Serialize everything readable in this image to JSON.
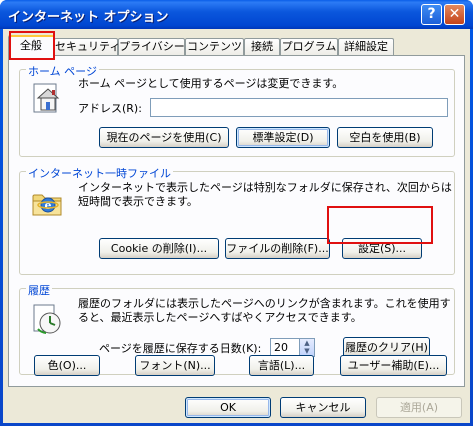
{
  "window": {
    "title": "インターネット オプション",
    "help_label": "?",
    "close_label": "✕"
  },
  "tabs": [
    "全般",
    "セキュリティ",
    "プライバシー",
    "コンテンツ",
    "接続",
    "プログラム",
    "詳細設定"
  ],
  "home": {
    "title": "ホーム ページ",
    "description": "ホーム ページとして使用するページは変更できます。",
    "address_label": "アドレス(R):",
    "address_value": "",
    "btn_current": "現在のページを使用(C)",
    "btn_default": "標準設定(D)",
    "btn_blank": "空白を使用(B)"
  },
  "temp_files": {
    "title": "インターネット一時ファイル",
    "description_line1": "インターネットで表示したページは特別なフォルダに保存され、次回からは",
    "description_line2": "短時間で表示できます。",
    "btn_delete_cookies": "Cookie の削除(I)...",
    "btn_delete_files": "ファイルの削除(F)...",
    "btn_settings": "設定(S)..."
  },
  "history": {
    "title": "履歴",
    "description_line1": "履歴のフォルダには表示したページへのリンクが含まれます。これを使用す",
    "description_line2": "ると、最近表示したページへすばやくアクセスできます。",
    "days_label": "ページを履歴に保存する日数(K):",
    "days_value": "20",
    "btn_clear": "履歴のクリア(H)"
  },
  "bottom_buttons": {
    "colors": "色(O)...",
    "fonts": "フォント(N)...",
    "languages": "言語(L)...",
    "accessibility": "ユーザー補助(E)..."
  },
  "dialog": {
    "ok": "OK",
    "cancel": "キャンセル",
    "apply": "適用(A)"
  },
  "colors": {
    "title_bar": "#0b57dd",
    "dialog_bg": "#ece9d8",
    "group_title": "#0046d5",
    "highlight_box": "#e01010"
  }
}
